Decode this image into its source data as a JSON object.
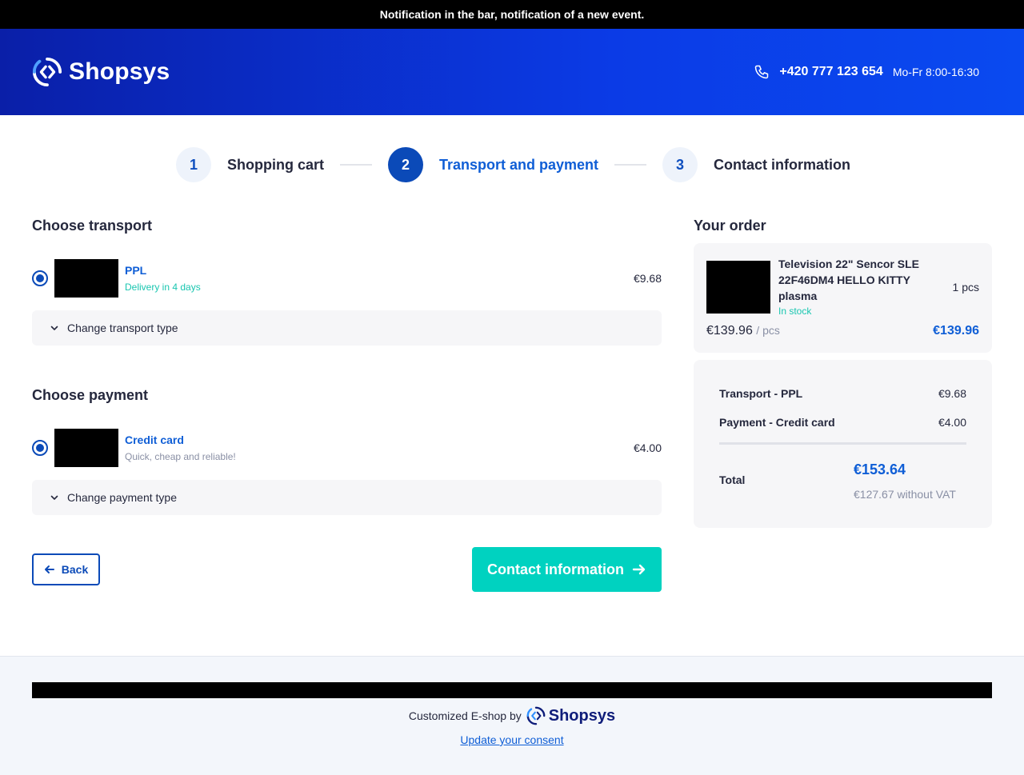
{
  "notification": "Notification in the bar, notification of a new event.",
  "header": {
    "logo_text": "Shopsys",
    "phone": "+420 777 123 654",
    "hours": "Mo-Fr 8:00-16:30"
  },
  "steps": [
    {
      "number": "1",
      "label": "Shopping cart"
    },
    {
      "number": "2",
      "label": "Transport and payment"
    },
    {
      "number": "3",
      "label": "Contact information"
    }
  ],
  "transport": {
    "title": "Choose transport",
    "selected": {
      "name": "PPL",
      "subtitle": "Delivery in 4 days",
      "price": "€9.68"
    },
    "change_label": "Change transport type"
  },
  "payment": {
    "title": "Choose payment",
    "selected": {
      "name": "Credit card",
      "subtitle": "Quick, cheap and reliable!",
      "price": "€4.00"
    },
    "change_label": "Change payment type"
  },
  "actions": {
    "back_label": "Back",
    "next_label": "Contact information"
  },
  "order": {
    "title": "Your order",
    "item": {
      "name": "Television 22\" Sencor SLE 22F46DM4 HELLO KITTY plasma",
      "stock": "In stock",
      "qty": "1 pcs",
      "unit_price": "€139.96",
      "unit_suffix": "/ pcs",
      "total": "€139.96"
    },
    "summary": {
      "transport_label": "Transport - PPL",
      "transport_value": "€9.68",
      "payment_label": "Payment - Credit card",
      "payment_value": "€4.00",
      "total_label": "Total",
      "total_value": "€153.64",
      "total_without_vat": "€127.67 without VAT"
    }
  },
  "footer": {
    "credit_text": "Customized E-shop by",
    "credit_logo": "Shopsys",
    "consent_link": "Update your consent"
  },
  "colors": {
    "brand_blue": "#0b4ab8",
    "accent_teal": "#00d2c0",
    "link_blue": "#0f5ed6"
  }
}
